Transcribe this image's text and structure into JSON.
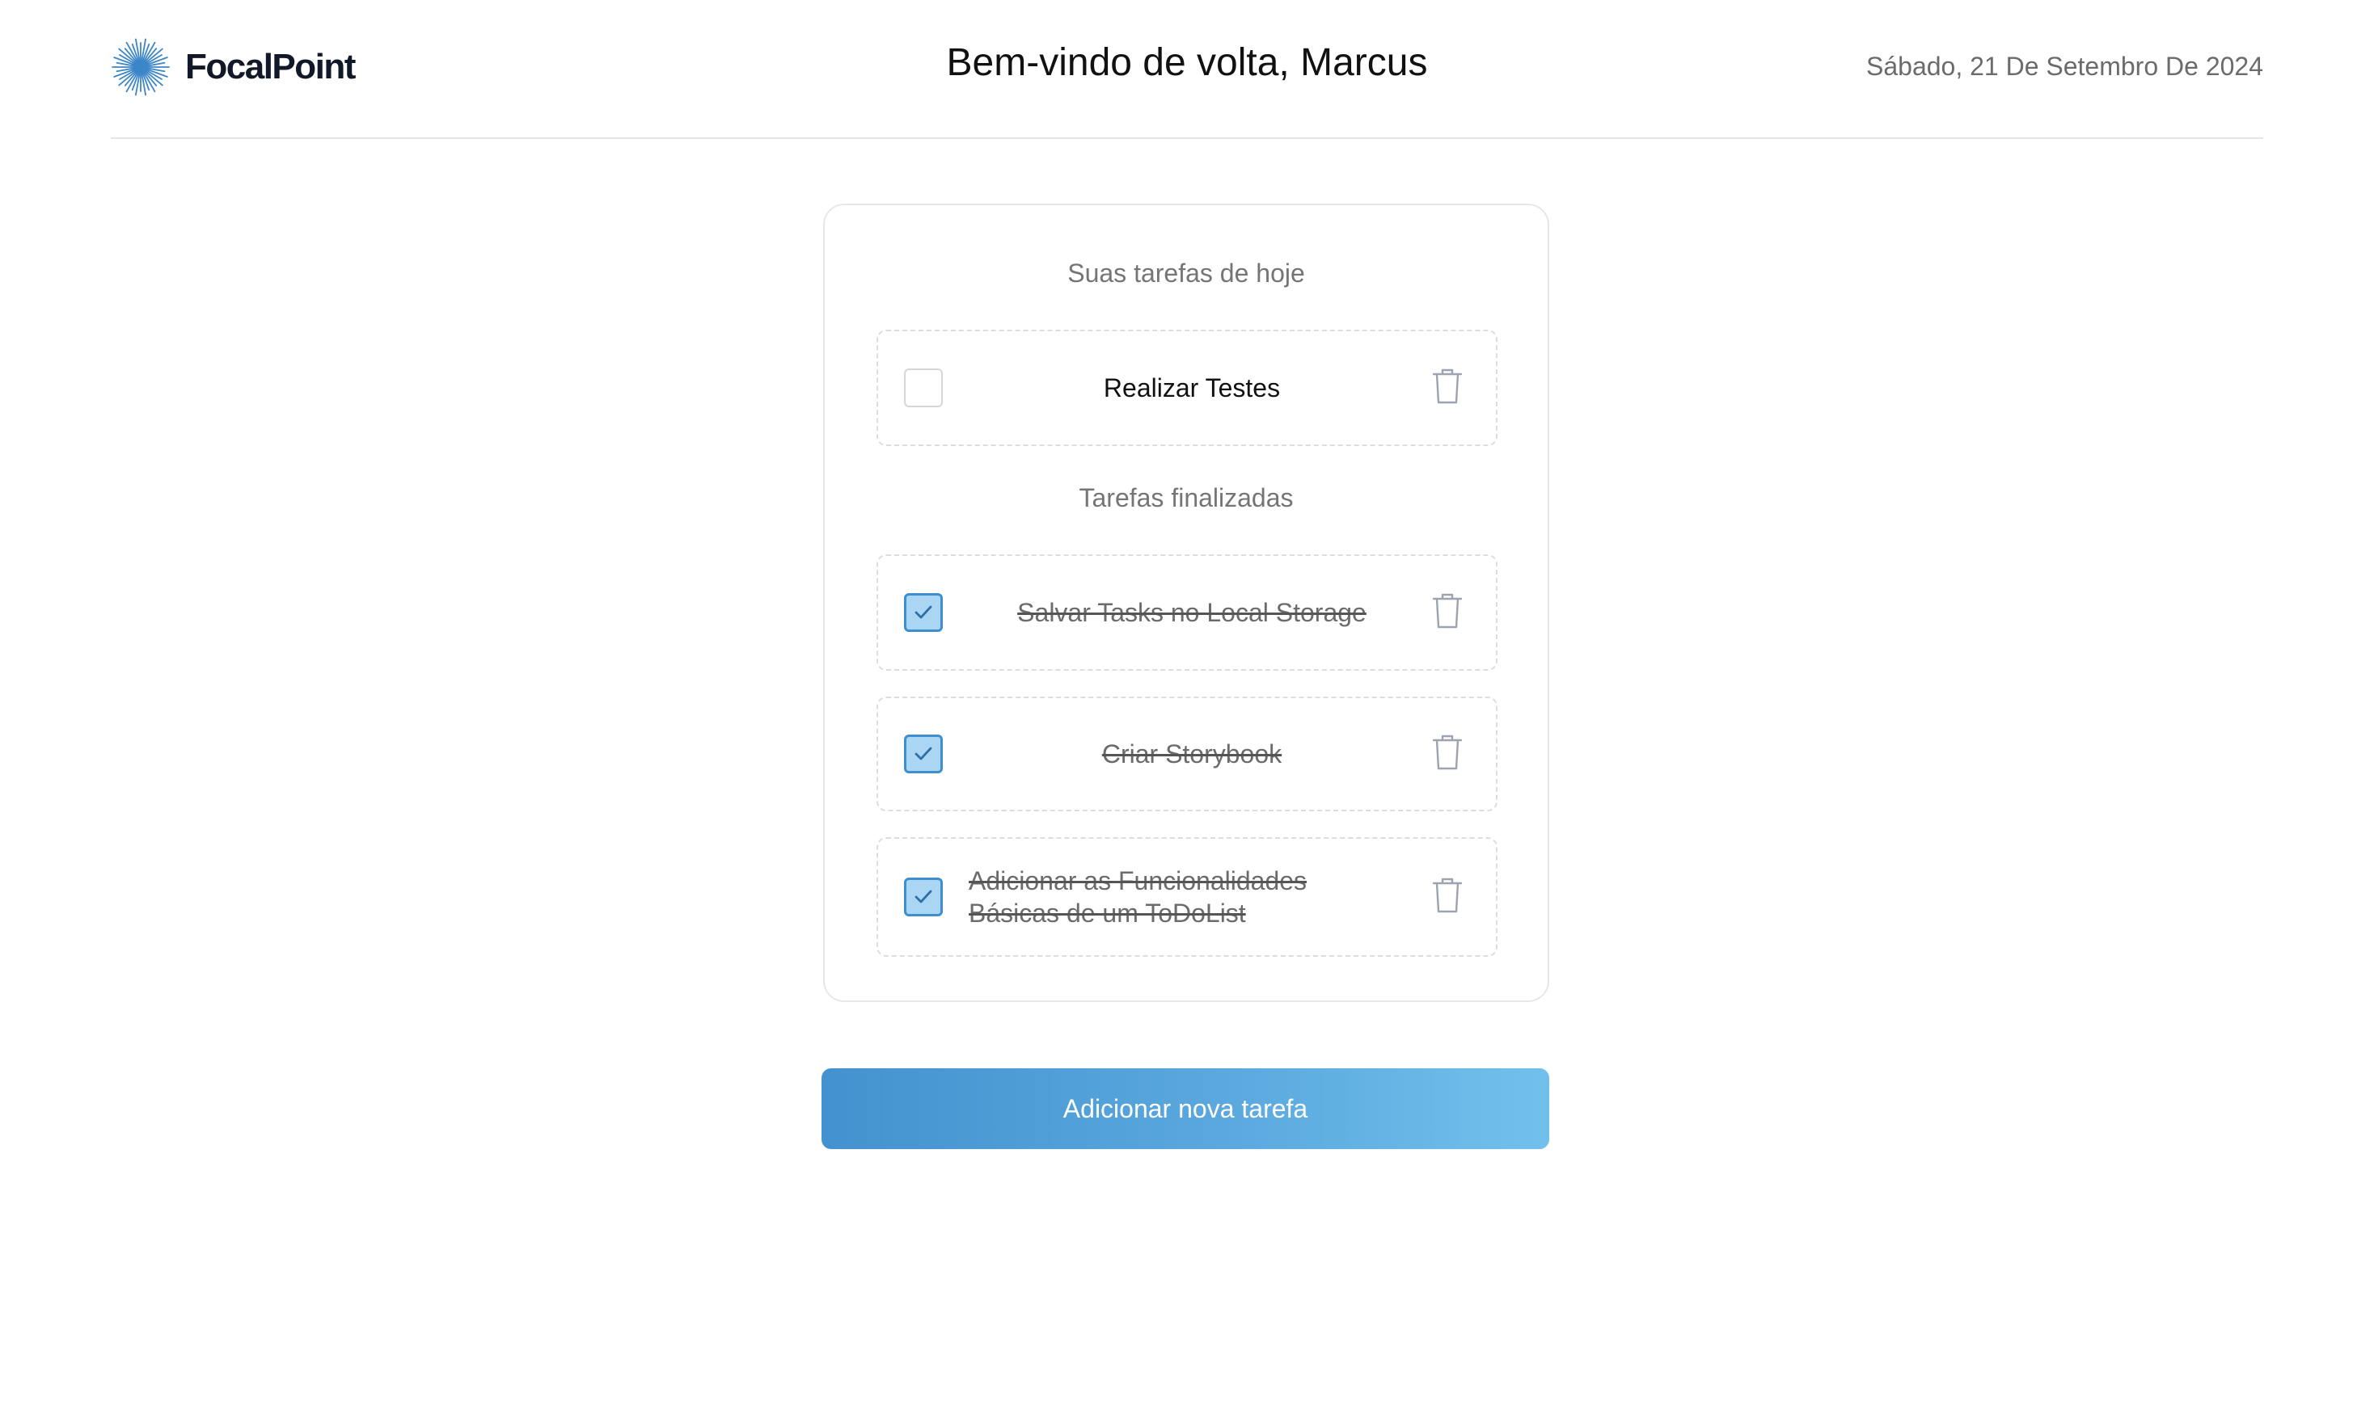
{
  "header": {
    "brand_name": "FocalPoint",
    "brand_icon": "starburst-logo",
    "greeting": "Bem-vindo de volta, Marcus",
    "date": "Sábado, 21 De Setembro De 2024"
  },
  "today": {
    "title": "Suas tarefas de hoje",
    "tasks": [
      {
        "text": "Realizar Testes",
        "completed": false
      }
    ]
  },
  "finished": {
    "title": "Tarefas finalizadas",
    "tasks": [
      {
        "text": "Salvar Tasks no Local Storage",
        "completed": true
      },
      {
        "text": "Criar Storybook",
        "completed": true
      },
      {
        "text": "Adicionar as Funcionalidades Básicas de um ToDoList",
        "completed": true
      }
    ]
  },
  "actions": {
    "add_task_label": "Adicionar nova tarefa"
  },
  "colors": {
    "accent": "#4392cf",
    "checkbox_fill": "#aad6f3",
    "muted_text": "#757575"
  },
  "icons": {
    "delete": "trash-icon",
    "check": "check-icon"
  }
}
